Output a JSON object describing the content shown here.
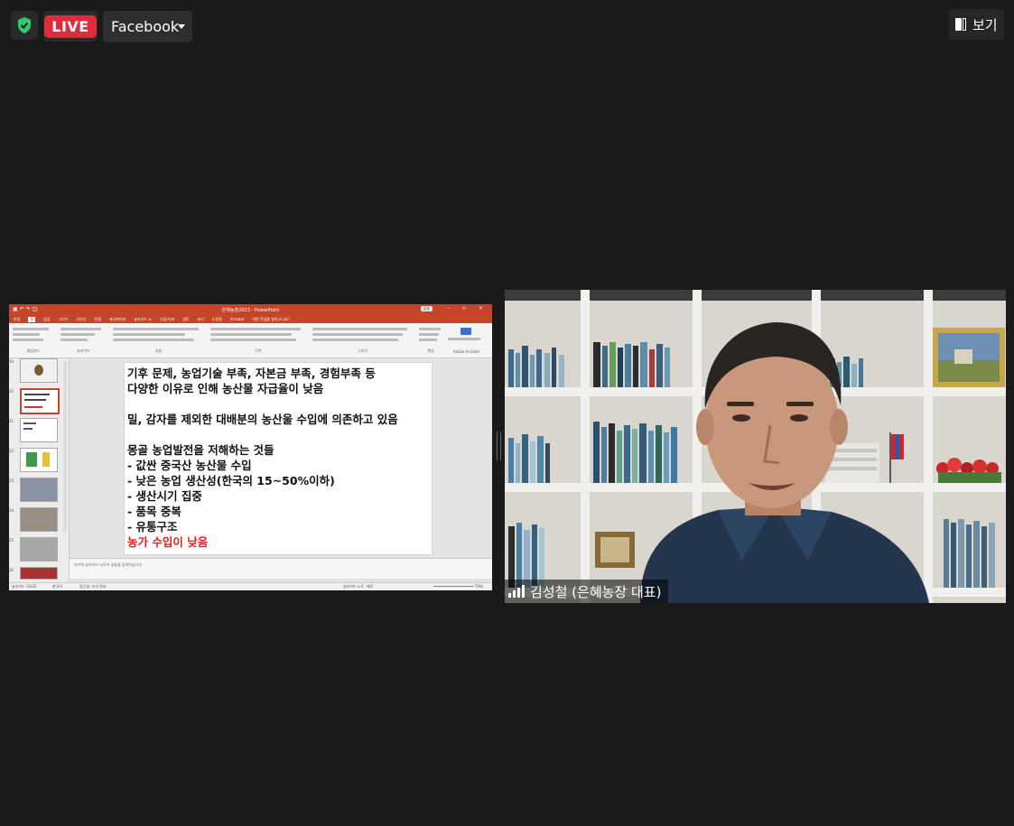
{
  "top_bar": {
    "live_label": "LIVE",
    "platform_selected": "Facebook",
    "view_label": "보기"
  },
  "powerpoint": {
    "window_title": "은혜농장2023 - PowerPoint",
    "share_button": "공유",
    "tabs": [
      "파일",
      "홈",
      "삽입",
      "그리기",
      "디자인",
      "전환",
      "애니메이션",
      "슬라이드 쇼",
      "녹음/녹화",
      "검토",
      "보기",
      "도움말",
      "Acrobat",
      "어떤 작업을 원하시나요?"
    ],
    "ribbon_groups": [
      "클립보드",
      "슬라이드",
      "글꼴",
      "단락",
      "그리기",
      "편집",
      "Adobe Acrobat"
    ],
    "thumbnail_numbers": [
      "19",
      "20",
      "21",
      "22",
      "23",
      "24",
      "25",
      "26"
    ],
    "slide_lines": [
      "기후 문제, 농업기술 부족, 자본금 부족, 경험부족 등",
      "다양한 이유로 인해 농산물 자급율이 낮음",
      "",
      "밀, 감자를  제외한 대배분의 농산울 수입에 의존하고 있음",
      "",
      "몽골 농업발전을 저해하는 것들",
      "- 값싼 중국산 농산물 수입",
      "- 낮은 농업 생산성(한국의 15~50%이하)",
      "- 생산시기 집중",
      "- 품목 중복",
      "- 유통구조"
    ],
    "slide_highlight": "농가 수입이 낮음",
    "notes_placeholder": "여기에 슬라이드 노트의 내용을 입력하십시오",
    "status_left": "슬라이드 20/32",
    "status_lang": "한국어",
    "status_access": "접근성: 조사 필요",
    "status_notes": "슬라이드 노트",
    "status_comments": "메모",
    "zoom": "79%"
  },
  "participant": {
    "name": "김성철 (은혜농장 대표)"
  },
  "colors": {
    "background": "#1a1a1a",
    "live_red": "#e02b3a",
    "powerpoint_orange": "#c5442a",
    "shield_green": "#2ecc71"
  }
}
